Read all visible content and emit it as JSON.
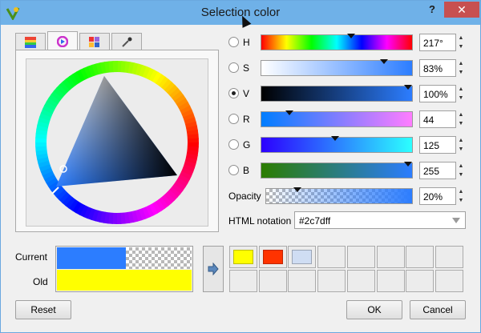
{
  "window": {
    "title": "Selection color",
    "help": "?",
    "close": "✕"
  },
  "tabs": [
    {
      "name": "ramp-tab-icon",
      "active": false
    },
    {
      "name": "triangle-wheel-tab-icon",
      "active": true
    },
    {
      "name": "swatch-grid-tab-icon",
      "active": false
    },
    {
      "name": "eyedropper-tab-icon",
      "active": false
    }
  ],
  "channels": {
    "h": {
      "label": "H",
      "value": "217°",
      "position": 0.6,
      "checked": false
    },
    "s": {
      "label": "S",
      "value": "83%",
      "position": 0.83,
      "checked": false
    },
    "v": {
      "label": "V",
      "value": "100%",
      "position": 1.0,
      "checked": true
    },
    "r": {
      "label": "R",
      "value": "44",
      "position": 0.17,
      "checked": false
    },
    "g": {
      "label": "G",
      "value": "125",
      "position": 0.49,
      "checked": false
    },
    "b": {
      "label": "B",
      "value": "255",
      "position": 1.0,
      "checked": false
    }
  },
  "opacity": {
    "label": "Opacity",
    "value": "20%",
    "position": 0.2
  },
  "html_notation": {
    "label": "HTML notation",
    "value": "#2c7dff"
  },
  "preview": {
    "current_label": "Current",
    "old_label": "Old",
    "current_color": "#2c7dff",
    "old_color": "#ffff00"
  },
  "swatches": [
    "#ffff00",
    "#ff3300",
    "#cfddf3",
    "",
    "",
    "",
    "",
    "",
    "",
    "",
    "",
    "",
    "",
    "",
    "",
    ""
  ],
  "buttons": {
    "reset": "Reset",
    "ok": "OK",
    "cancel": "Cancel"
  },
  "colors": {
    "titlebar": "#6fb1e8",
    "close": "#c75050",
    "selected": "#2c7dff"
  }
}
